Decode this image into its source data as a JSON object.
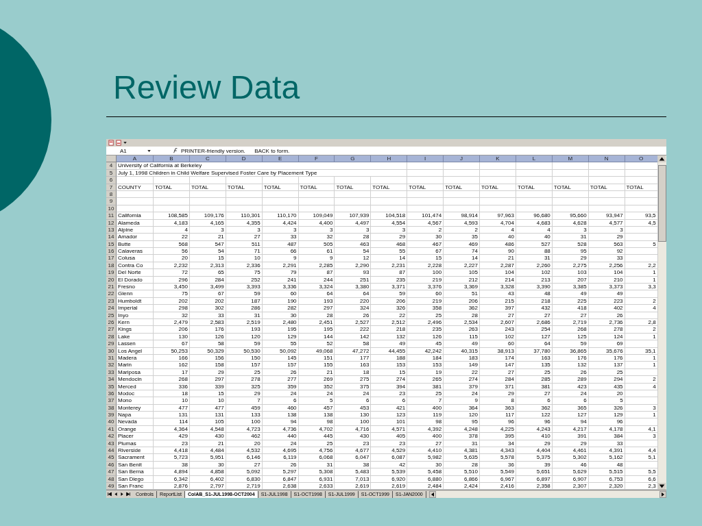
{
  "slide": {
    "title": "Review Data"
  },
  "spreadsheet": {
    "name_box": "A1",
    "formula": "PRINTER-friendly version.      BACK to form.",
    "columns": [
      "A",
      "B",
      "C",
      "D",
      "E",
      "F",
      "G",
      "H",
      "I",
      "J",
      "K",
      "L",
      "M",
      "N",
      "O"
    ],
    "rows": [
      {
        "row": "4",
        "kind": "title",
        "cells": [
          "University of California at Berkeley"
        ]
      },
      {
        "row": "5",
        "kind": "title",
        "cells": [
          "July 1, 1998 Children in Child Welfare Supervised Foster Care by Placement Type"
        ]
      },
      {
        "row": "6",
        "kind": "blank"
      },
      {
        "row": "7",
        "kind": "header",
        "cells": [
          "COUNTY",
          "TOTAL",
          "TOTAL",
          "TOTAL",
          "TOTAL",
          "TOTAL",
          "TOTAL",
          "TOTAL",
          "TOTAL",
          "TOTAL",
          "TOTAL",
          "TOTAL",
          "TOTAL",
          "TOTAL",
          "TOTAL"
        ]
      },
      {
        "row": "8",
        "kind": "blank"
      },
      {
        "row": "9",
        "kind": "blank"
      },
      {
        "row": "10",
        "kind": "blank"
      },
      {
        "row": "11",
        "kind": "data",
        "cells": [
          "California",
          "108,585",
          "109,176",
          "110,301",
          "110,170",
          "109,049",
          "107,939",
          "104,518",
          "101,474",
          "98,914",
          "97,963",
          "96,680",
          "95,660",
          "93,947",
          "93,5"
        ]
      },
      {
        "row": "12",
        "kind": "data",
        "cells": [
          "Alameda",
          "4,183",
          "4,165",
          "4,355",
          "4,424",
          "4,400",
          "4,497",
          "4,554",
          "4,567",
          "4,593",
          "4,704",
          "4,683",
          "4,628",
          "4,577",
          "4,5"
        ]
      },
      {
        "row": "13",
        "kind": "data",
        "cells": [
          "Alpine",
          "4",
          "3",
          "3",
          "3",
          "3",
          "3",
          "3",
          "2",
          "2",
          "4",
          "4",
          "3",
          "3",
          null
        ]
      },
      {
        "row": "14",
        "kind": "data",
        "cells": [
          "Amador",
          "22",
          "21",
          "27",
          "33",
          "32",
          "28",
          "29",
          "30",
          "35",
          "40",
          "40",
          "31",
          "29",
          null
        ]
      },
      {
        "row": "15",
        "kind": "data",
        "cells": [
          "Butte",
          "568",
          "547",
          "511",
          "487",
          "505",
          "463",
          "468",
          "467",
          "469",
          "486",
          "527",
          "528",
          "563",
          "5"
        ]
      },
      {
        "row": "16",
        "kind": "data",
        "cells": [
          "Calaveras",
          "56",
          "54",
          "71",
          "66",
          "61",
          "54",
          "55",
          "67",
          "74",
          "90",
          "88",
          "95",
          "92",
          null
        ]
      },
      {
        "row": "17",
        "kind": "data",
        "cells": [
          "Colusa",
          "20",
          "15",
          "10",
          "9",
          "9",
          "12",
          "14",
          "15",
          "14",
          "21",
          "31",
          "29",
          "33",
          null
        ]
      },
      {
        "row": "18",
        "kind": "data",
        "cells": [
          "Contra Co",
          "2,232",
          "2,313",
          "2,336",
          "2,291",
          "2,285",
          "2,290",
          "2,231",
          "2,228",
          "2,227",
          "2,287",
          "2,260",
          "2,275",
          "2,256",
          "2,2"
        ]
      },
      {
        "row": "19",
        "kind": "data",
        "cells": [
          "Del Norte",
          "72",
          "65",
          "75",
          "79",
          "87",
          "93",
          "87",
          "100",
          "105",
          "104",
          "102",
          "103",
          "104",
          "1"
        ]
      },
      {
        "row": "20",
        "kind": "data",
        "cells": [
          "El Dorado",
          "296",
          "284",
          "252",
          "241",
          "244",
          "251",
          "235",
          "219",
          "212",
          "214",
          "213",
          "207",
          "210",
          "1"
        ]
      },
      {
        "row": "21",
        "kind": "data",
        "cells": [
          "Fresno",
          "3,450",
          "3,499",
          "3,393",
          "3,336",
          "3,324",
          "3,380",
          "3,371",
          "3,376",
          "3,369",
          "3,328",
          "3,390",
          "3,385",
          "3,373",
          "3,3"
        ]
      },
      {
        "row": "22",
        "kind": "data",
        "cells": [
          "Glenn",
          "75",
          "67",
          "59",
          "60",
          "64",
          "64",
          "59",
          "60",
          "51",
          "43",
          "48",
          "49",
          "49",
          null
        ]
      },
      {
        "row": "23",
        "kind": "data",
        "cells": [
          "Humboldt",
          "202",
          "202",
          "187",
          "190",
          "193",
          "220",
          "206",
          "219",
          "206",
          "215",
          "218",
          "225",
          "223",
          "2"
        ]
      },
      {
        "row": "24",
        "kind": "data",
        "cells": [
          "Imperial",
          "298",
          "302",
          "286",
          "282",
          "297",
          "324",
          "326",
          "358",
          "362",
          "397",
          "432",
          "418",
          "402",
          "4"
        ]
      },
      {
        "row": "25",
        "kind": "data",
        "cells": [
          "Inyo",
          "32",
          "33",
          "31",
          "30",
          "28",
          "26",
          "22",
          "25",
          "28",
          "27",
          "27",
          "27",
          "26",
          null
        ]
      },
      {
        "row": "26",
        "kind": "data",
        "cells": [
          "Kern",
          "2,479",
          "2,583",
          "2,519",
          "2,480",
          "2,451",
          "2,527",
          "2,512",
          "2,496",
          "2,534",
          "2,607",
          "2,686",
          "2,719",
          "2,736",
          "2,8"
        ]
      },
      {
        "row": "27",
        "kind": "data",
        "cells": [
          "Kings",
          "206",
          "176",
          "193",
          "195",
          "195",
          "222",
          "218",
          "235",
          "263",
          "243",
          "254",
          "268",
          "278",
          "2"
        ]
      },
      {
        "row": "28",
        "kind": "data",
        "cells": [
          "Lake",
          "130",
          "126",
          "120",
          "129",
          "144",
          "142",
          "132",
          "126",
          "115",
          "102",
          "127",
          "125",
          "124",
          "1"
        ]
      },
      {
        "row": "29",
        "kind": "data",
        "cells": [
          "Lassen",
          "67",
          "58",
          "59",
          "55",
          "52",
          "58",
          "49",
          "45",
          "49",
          "60",
          "64",
          "59",
          "69",
          null
        ]
      },
      {
        "row": "30",
        "kind": "data",
        "cells": [
          "Los Angel",
          "50,253",
          "50,329",
          "50,530",
          "50,092",
          "49,068",
          "47,272",
          "44,455",
          "42,242",
          "40,315",
          "38,913",
          "37,780",
          "36,865",
          "35,676",
          "35,1"
        ]
      },
      {
        "row": "31",
        "kind": "data",
        "cells": [
          "Madera",
          "166",
          "156",
          "150",
          "145",
          "151",
          "177",
          "188",
          "184",
          "183",
          "174",
          "163",
          "176",
          "176",
          "1"
        ]
      },
      {
        "row": "32",
        "kind": "data",
        "cells": [
          "Marin",
          "162",
          "158",
          "157",
          "157",
          "155",
          "163",
          "153",
          "153",
          "149",
          "147",
          "135",
          "132",
          "137",
          "1"
        ]
      },
      {
        "row": "33",
        "kind": "data",
        "cells": [
          "Mariposa",
          "17",
          "29",
          "25",
          "26",
          "21",
          "18",
          "15",
          "19",
          "22",
          "27",
          "25",
          "26",
          "25",
          null
        ]
      },
      {
        "row": "34",
        "kind": "data",
        "cells": [
          "Mendocin",
          "268",
          "297",
          "278",
          "277",
          "269",
          "275",
          "274",
          "265",
          "274",
          "284",
          "285",
          "289",
          "294",
          "2"
        ]
      },
      {
        "row": "35",
        "kind": "data",
        "cells": [
          "Merced",
          "336",
          "339",
          "325",
          "359",
          "352",
          "375",
          "394",
          "381",
          "379",
          "371",
          "381",
          "423",
          "435",
          "4"
        ]
      },
      {
        "row": "36",
        "kind": "data",
        "cells": [
          "Modoc",
          "18",
          "15",
          "29",
          "24",
          "24",
          "24",
          "23",
          "25",
          "24",
          "29",
          "27",
          "24",
          "20",
          null
        ]
      },
      {
        "row": "37",
        "kind": "data",
        "cells": [
          "Mono",
          "10",
          "10",
          "7",
          "6",
          "5",
          "6",
          "6",
          "7",
          "9",
          "8",
          "6",
          "6",
          "5",
          null
        ]
      },
      {
        "row": "38",
        "kind": "data",
        "cells": [
          "Monterey",
          "477",
          "477",
          "459",
          "460",
          "457",
          "453",
          "421",
          "400",
          "364",
          "363",
          "362",
          "365",
          "326",
          "3"
        ]
      },
      {
        "row": "39",
        "kind": "data",
        "cells": [
          "Napa",
          "131",
          "131",
          "133",
          "138",
          "138",
          "130",
          "123",
          "119",
          "120",
          "117",
          "122",
          "127",
          "129",
          "1"
        ]
      },
      {
        "row": "40",
        "kind": "data",
        "cells": [
          "Nevada",
          "114",
          "105",
          "100",
          "94",
          "98",
          "100",
          "101",
          "98",
          "95",
          "96",
          "96",
          "94",
          "96",
          null
        ]
      },
      {
        "row": "41",
        "kind": "data",
        "cells": [
          "Orange",
          "4,364",
          "4,548",
          "4,723",
          "4,736",
          "4,702",
          "4,716",
          "4,571",
          "4,392",
          "4,248",
          "4,225",
          "4,243",
          "4,217",
          "4,178",
          "4,1"
        ]
      },
      {
        "row": "42",
        "kind": "data",
        "cells": [
          "Placer",
          "429",
          "430",
          "462",
          "440",
          "445",
          "430",
          "405",
          "400",
          "378",
          "395",
          "410",
          "391",
          "384",
          "3"
        ]
      },
      {
        "row": "43",
        "kind": "data",
        "cells": [
          "Plumas",
          "23",
          "21",
          "20",
          "24",
          "25",
          "23",
          "23",
          "27",
          "31",
          "34",
          "29",
          "29",
          "33",
          null
        ]
      },
      {
        "row": "44",
        "kind": "data",
        "cells": [
          "Riverside",
          "4,418",
          "4,484",
          "4,532",
          "4,695",
          "4,756",
          "4,677",
          "4,529",
          "4,410",
          "4,381",
          "4,343",
          "4,404",
          "4,461",
          "4,391",
          "4,4"
        ]
      },
      {
        "row": "45",
        "kind": "data",
        "cells": [
          "Sacrament",
          "5,723",
          "5,951",
          "6,146",
          "6,119",
          "6,068",
          "6,047",
          "6,087",
          "5,982",
          "5,635",
          "5,578",
          "5,375",
          "5,302",
          "5,162",
          "5,1"
        ]
      },
      {
        "row": "46",
        "kind": "data",
        "cells": [
          "San Benit",
          "38",
          "30",
          "27",
          "26",
          "31",
          "38",
          "42",
          "30",
          "28",
          "36",
          "39",
          "46",
          "48",
          null
        ]
      },
      {
        "row": "47",
        "kind": "data",
        "cells": [
          "San Berna",
          "4,894",
          "4,858",
          "5,092",
          "5,297",
          "5,308",
          "5,483",
          "5,539",
          "5,458",
          "5,510",
          "5,549",
          "5,651",
          "5,629",
          "5,515",
          "5,5"
        ]
      },
      {
        "row": "48",
        "kind": "data",
        "cells": [
          "San Diego",
          "6,342",
          "6,402",
          "6,830",
          "6,847",
          "6,931",
          "7,013",
          "6,920",
          "6,880",
          "6,866",
          "6,967",
          "6,897",
          "6,907",
          "6,753",
          "6,6"
        ]
      },
      {
        "row": "49",
        "kind": "data",
        "cells": [
          "San Franc",
          "2,876",
          "2,797",
          "2,719",
          "2,638",
          "2,633",
          "2,619",
          "2,619",
          "2,484",
          "2,424",
          "2,416",
          "2,358",
          "2,307",
          "2,320",
          "2,3"
        ]
      }
    ],
    "sheet_tabs": [
      {
        "label": "Controls",
        "selected": false
      },
      {
        "label": "ReportList",
        "selected": false
      },
      {
        "label": "ColAB_S1-JUL1998-OCT2004",
        "selected": true
      },
      {
        "label": "S1-JUL1998",
        "selected": false
      },
      {
        "label": "S1-OCT1998",
        "selected": false
      },
      {
        "label": "S1-JUL1999",
        "selected": false
      },
      {
        "label": "S1-OCT1999",
        "selected": false
      },
      {
        "label": "S1-JAN2000",
        "selected": false
      }
    ]
  }
}
